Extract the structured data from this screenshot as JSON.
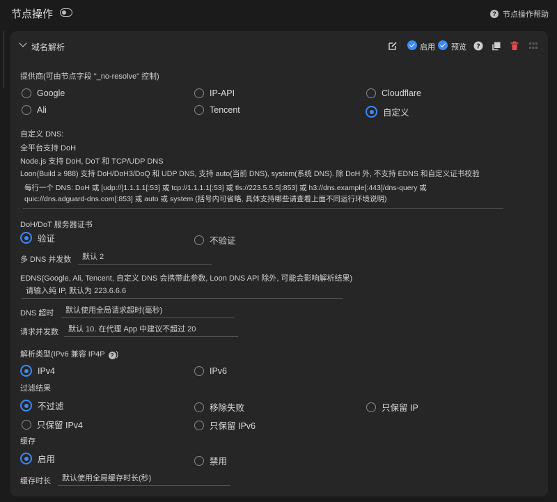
{
  "page": {
    "title": "节点操作",
    "help": "节点操作帮助"
  },
  "card": {
    "title": "域名解析",
    "enable_label": "启用",
    "preview_label": "预览"
  },
  "provider": {
    "label": "提供商(可由节点字段 \"_no-resolve\" 控制)",
    "options": [
      "Google",
      "IP-API",
      "Cloudflare",
      "Ali",
      "Tencent",
      "自定义"
    ],
    "selected": "自定义"
  },
  "custom_dns": {
    "heading": "自定义 DNS:",
    "notes": [
      "全平台支持 DoH",
      "Node.js 支持 DoH, DoT 和 TCP/UDP DNS",
      "Loon(Build ≥ 988) 支持 DoH/DoH3/DoQ 和 UDP DNS, 支持 auto(当前 DNS), system(系统 DNS). 除 DoH 外, 不支持 EDNS 和自定义证书校验"
    ],
    "placeholder_line1": "每行一个 DNS: DoH 或 [udp://]1.1.1.1[:53] 或 tcp://1.1.1.1[:53] 或 tls://223.5.5.5[:853] 或 h3://dns.example[:443]/dns-query 或",
    "placeholder_line2": "quic://dns.adguard-dns.com[:853] 或 auto 或 system (括号内可省略, 具体支持哪些请查看上面不同运行环境说明)"
  },
  "cert": {
    "label": "DoH/DoT 服务器证书",
    "options": [
      "验证",
      "不验证"
    ],
    "selected": "验证"
  },
  "concurrency": {
    "label": "多 DNS 并发数",
    "placeholder": "默认 2"
  },
  "edns": {
    "label": "EDNS(Google, Ali, Tencent, 自定义 DNS 会携带此参数, Loon DNS API 除外, 可能会影响解析结果)",
    "placeholder": "请输入纯 IP, 默认为 223.6.6.6"
  },
  "timeout": {
    "label": "DNS 超时",
    "placeholder": "默认使用全局请求超时(毫秒)"
  },
  "req_concurrency": {
    "label": "请求并发数",
    "placeholder": "默认 10. 在代理 App 中建议不超过 20"
  },
  "resolve_type": {
    "label": "解析类型(IPv6 兼容 IP4P",
    "options": [
      "IPv4",
      "IPv6"
    ],
    "selected": "IPv4"
  },
  "filter": {
    "label": "过滤结果",
    "options": [
      "不过滤",
      "移除失败",
      "只保留 IP",
      "只保留 IPv4",
      "只保留 IPv6"
    ],
    "selected": "不过滤"
  },
  "cache": {
    "label": "缓存",
    "options": [
      "启用",
      "禁用"
    ],
    "selected": "启用"
  },
  "cache_ttl": {
    "label": "缓存时长",
    "placeholder": "默认使用全局缓存时长(秒)"
  },
  "colors": {
    "accent": "#3d8af7",
    "delete": "#e5484d",
    "card": "#262626",
    "background": "#1b1b1b"
  },
  "icons": [
    "toggle-icon",
    "help-icon",
    "chevron-down-icon",
    "edit-icon",
    "check-icon",
    "question-icon",
    "copy-icon",
    "trash-icon",
    "drag-handle-icon"
  ]
}
